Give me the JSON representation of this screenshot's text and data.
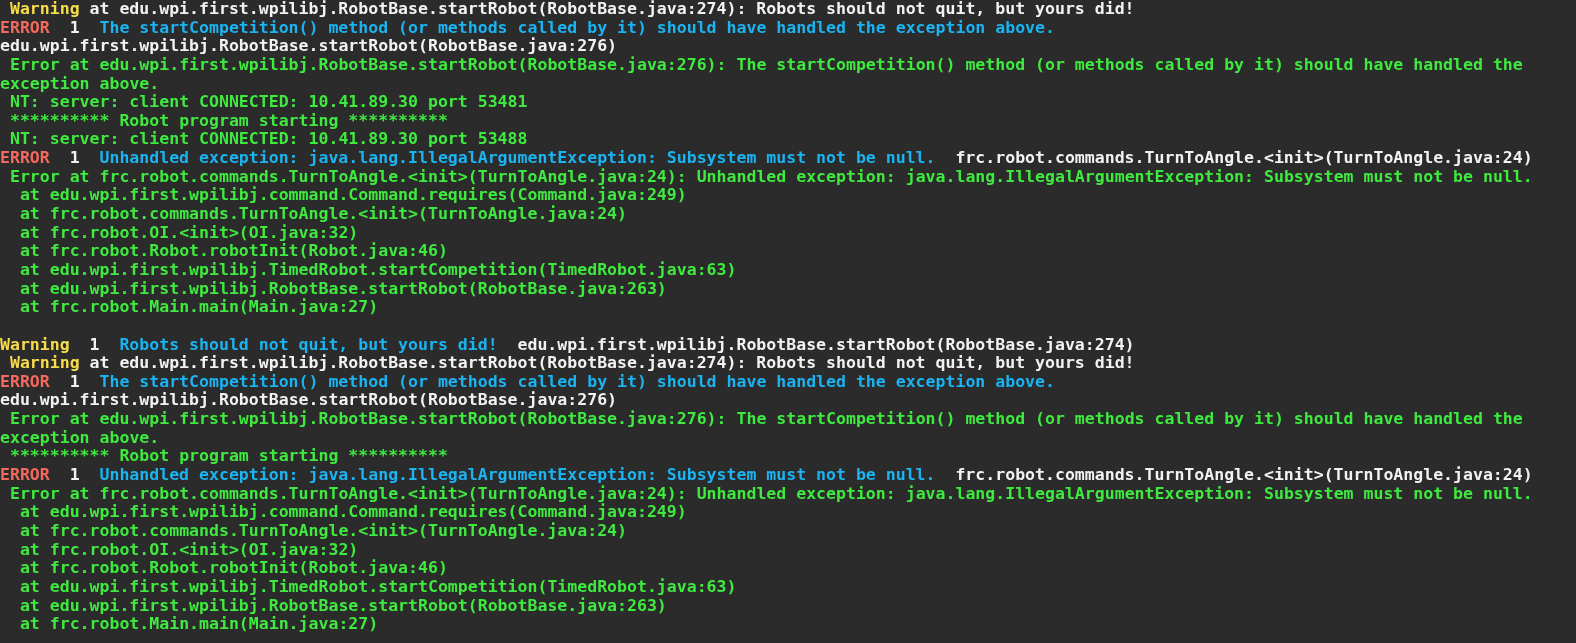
{
  "console_lines": [
    {
      "kind": "warning_detail",
      "tag": "Warning",
      "text": "at edu.wpi.first.wpilibj.RobotBase.startRobot(RobotBase.java:274): Robots should not quit, but yours did!"
    },
    {
      "kind": "report",
      "color": "#f4695e",
      "label": "ERROR",
      "count": "1",
      "message": "The startCompetition() method (or methods called by it) should have handled the exception above."
    },
    {
      "kind": "plain",
      "text": "edu.wpi.first.wpilibj.RobotBase.startRobot(RobotBase.java:276)"
    },
    {
      "kind": "log",
      "text": "Error at edu.wpi.first.wpilibj.RobotBase.startRobot(RobotBase.java:276): The startCompetition() method (or methods called by it) should have handled the"
    },
    {
      "kind": "continuation",
      "text": "exception above."
    },
    {
      "kind": "log",
      "text": "NT: server: client CONNECTED: 10.41.89.30 port 53481"
    },
    {
      "kind": "log",
      "text": "********** Robot program starting **********"
    },
    {
      "kind": "log",
      "text": "NT: server: client CONNECTED: 10.41.89.30 port 53488"
    },
    {
      "kind": "report",
      "color": "#f4695e",
      "label": "ERROR",
      "count": "1",
      "message": "Unhandled exception: java.lang.IllegalArgumentException: Subsystem must not be null.",
      "location": "frc.robot.commands.TurnToAngle.<init>(TurnToAngle.java:24)"
    },
    {
      "kind": "log",
      "text": "Error at frc.robot.commands.TurnToAngle.<init>(TurnToAngle.java:24): Unhandled exception: java.lang.IllegalArgumentException: Subsystem must not be null."
    },
    {
      "kind": "trace",
      "text": "at edu.wpi.first.wpilibj.command.Command.requires(Command.java:249)"
    },
    {
      "kind": "trace",
      "text": "at frc.robot.commands.TurnToAngle.<init>(TurnToAngle.java:24)"
    },
    {
      "kind": "trace",
      "text": "at frc.robot.OI.<init>(OI.java:32)"
    },
    {
      "kind": "trace",
      "text": "at frc.robot.Robot.robotInit(Robot.java:46)"
    },
    {
      "kind": "trace",
      "text": "at edu.wpi.first.wpilibj.TimedRobot.startCompetition(TimedRobot.java:63)"
    },
    {
      "kind": "trace",
      "text": "at edu.wpi.first.wpilibj.RobotBase.startRobot(RobotBase.java:263)"
    },
    {
      "kind": "trace",
      "text": "at frc.robot.Main.main(Main.java:27)"
    },
    {
      "kind": "blank"
    },
    {
      "kind": "report",
      "color": "#f7dc4a",
      "label": "Warning",
      "count": "1",
      "message": "Robots should not quit, but yours did!",
      "location": "edu.wpi.first.wpilibj.RobotBase.startRobot(RobotBase.java:274)"
    },
    {
      "kind": "warning_detail",
      "tag": "Warning",
      "text": "at edu.wpi.first.wpilibj.RobotBase.startRobot(RobotBase.java:274): Robots should not quit, but yours did!"
    },
    {
      "kind": "report",
      "color": "#f4695e",
      "label": "ERROR",
      "count": "1",
      "message": "The startCompetition() method (or methods called by it) should have handled the exception above."
    },
    {
      "kind": "plain",
      "text": "edu.wpi.first.wpilibj.RobotBase.startRobot(RobotBase.java:276)"
    },
    {
      "kind": "log",
      "text": "Error at edu.wpi.first.wpilibj.RobotBase.startRobot(RobotBase.java:276): The startCompetition() method (or methods called by it) should have handled the"
    },
    {
      "kind": "continuation",
      "text": "exception above."
    },
    {
      "kind": "log",
      "text": "********** Robot program starting **********"
    },
    {
      "kind": "report",
      "color": "#f4695e",
      "label": "ERROR",
      "count": "1",
      "message": "Unhandled exception: java.lang.IllegalArgumentException: Subsystem must not be null.",
      "location": "frc.robot.commands.TurnToAngle.<init>(TurnToAngle.java:24)"
    },
    {
      "kind": "log",
      "text": "Error at frc.robot.commands.TurnToAngle.<init>(TurnToAngle.java:24): Unhandled exception: java.lang.IllegalArgumentException: Subsystem must not be null."
    },
    {
      "kind": "trace",
      "text": "at edu.wpi.first.wpilibj.command.Command.requires(Command.java:249)"
    },
    {
      "kind": "trace",
      "text": "at frc.robot.commands.TurnToAngle.<init>(TurnToAngle.java:24)"
    },
    {
      "kind": "trace",
      "text": "at frc.robot.OI.<init>(OI.java:32)"
    },
    {
      "kind": "trace",
      "text": "at frc.robot.Robot.robotInit(Robot.java:46)"
    },
    {
      "kind": "trace",
      "text": "at edu.wpi.first.wpilibj.TimedRobot.startCompetition(TimedRobot.java:63)"
    },
    {
      "kind": "trace",
      "text": "at edu.wpi.first.wpilibj.RobotBase.startRobot(RobotBase.java:263)"
    },
    {
      "kind": "trace",
      "text": "at frc.robot.Main.main(Main.java:27)"
    }
  ]
}
